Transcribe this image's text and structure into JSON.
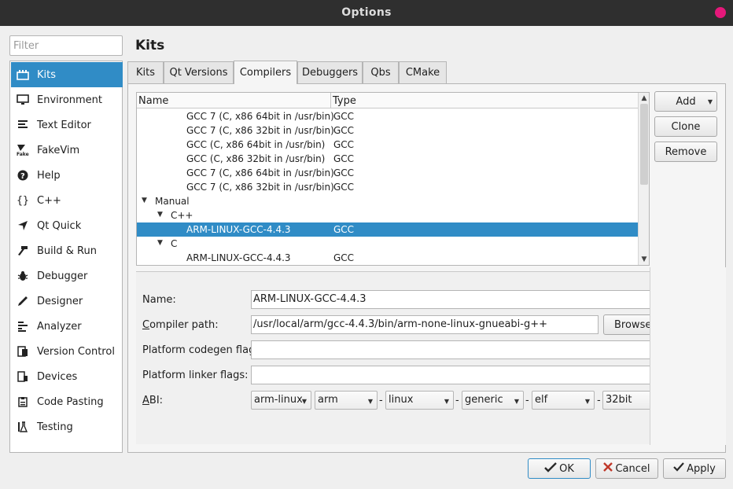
{
  "window": {
    "title": "Options"
  },
  "filter": {
    "placeholder": "Filter"
  },
  "sidebar": {
    "items": [
      {
        "label": "Kits",
        "icon": "kits-icon"
      },
      {
        "label": "Environment",
        "icon": "monitor-icon"
      },
      {
        "label": "Text Editor",
        "icon": "text-editor-icon"
      },
      {
        "label": "FakeVim",
        "icon": "fakevim-icon"
      },
      {
        "label": "Help",
        "icon": "help-icon"
      },
      {
        "label": "C++",
        "icon": "braces-icon"
      },
      {
        "label": "Qt Quick",
        "icon": "qt-quick-icon"
      },
      {
        "label": "Build & Run",
        "icon": "hammer-icon"
      },
      {
        "label": "Debugger",
        "icon": "bug-icon"
      },
      {
        "label": "Designer",
        "icon": "pen-icon"
      },
      {
        "label": "Analyzer",
        "icon": "analyzer-icon"
      },
      {
        "label": "Version Control",
        "icon": "version-control-icon"
      },
      {
        "label": "Devices",
        "icon": "devices-icon"
      },
      {
        "label": "Code Pasting",
        "icon": "clipboard-icon"
      },
      {
        "label": "Testing",
        "icon": "flask-icon"
      }
    ],
    "selected": "Kits"
  },
  "page": {
    "title": "Kits"
  },
  "tabs": [
    "Kits",
    "Qt Versions",
    "Compilers",
    "Debuggers",
    "Qbs",
    "CMake"
  ],
  "active_tab": "Compilers",
  "tree": {
    "headers": {
      "name": "Name",
      "type": "Type"
    },
    "rows": [
      {
        "name": "GCC 7 (C, x86 64bit in /usr/bin)",
        "type": "GCC"
      },
      {
        "name": "GCC 7 (C, x86 32bit in /usr/bin)",
        "type": "GCC"
      },
      {
        "name": "GCC (C, x86 64bit in /usr/bin)",
        "type": "GCC"
      },
      {
        "name": "GCC (C, x86 32bit in /usr/bin)",
        "type": "GCC"
      },
      {
        "name": "GCC 7 (C, x86 64bit in /usr/bin)",
        "type": "GCC"
      },
      {
        "name": "GCC 7 (C, x86 32bit in /usr/bin)",
        "type": "GCC"
      },
      {
        "name": "Manual",
        "type": ""
      },
      {
        "name": "C++",
        "type": ""
      },
      {
        "name": "ARM-LINUX-GCC-4.4.3",
        "type": "GCC"
      },
      {
        "name": "C",
        "type": ""
      },
      {
        "name": "ARM-LINUX-GCC-4.4.3",
        "type": "GCC"
      }
    ]
  },
  "side_buttons": {
    "add": "Add",
    "clone": "Clone",
    "remove": "Remove"
  },
  "details": {
    "name_label": "Name:",
    "name_value": "ARM-LINUX-GCC-4.4.3",
    "compiler_path_label": "Compiler path:",
    "compiler_path_value": "/usr/local/arm/gcc-4.4.3/bin/arm-none-linux-gnueabi-g++",
    "browse": "Browse...",
    "codegen_label": "Platform codegen flags:",
    "codegen_value": "",
    "linker_label": "Platform linker flags:",
    "linker_value": "",
    "abi_label": "ABI:",
    "abi": {
      "preset": "arm-linux",
      "architecture": "arm",
      "os": "linux",
      "flavor": "generic",
      "format": "elf",
      "width": "32bit",
      "separator": "-"
    }
  },
  "dialog_buttons": {
    "ok": "OK",
    "cancel": "Cancel",
    "apply": "Apply"
  },
  "colors": {
    "selection": "#308cc6",
    "close": "#e5187a",
    "titlebar": "#2f2f2f"
  }
}
